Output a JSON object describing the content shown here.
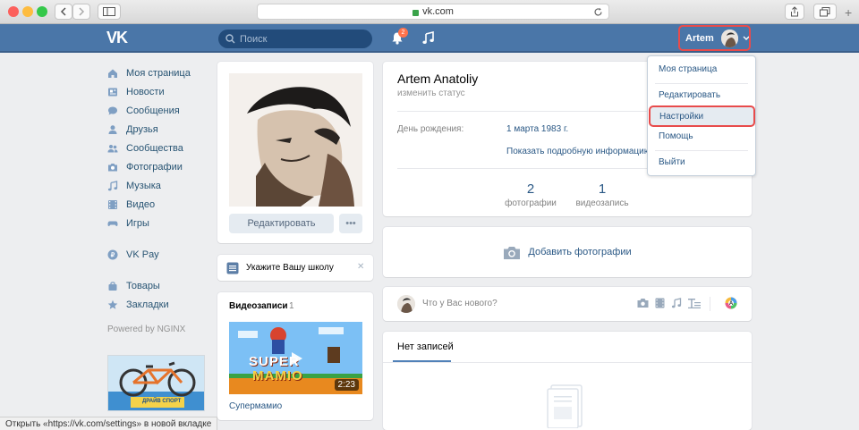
{
  "browser": {
    "url": "vk.com"
  },
  "header": {
    "logo": "VK",
    "search_placeholder": "Поиск",
    "notifications_count": "2",
    "profile_name": "Artem"
  },
  "left_menu": {
    "items": [
      {
        "label": "Моя страница",
        "icon": "home-icon"
      },
      {
        "label": "Новости",
        "icon": "news-icon"
      },
      {
        "label": "Сообщения",
        "icon": "messages-icon"
      },
      {
        "label": "Друзья",
        "icon": "friends-icon"
      },
      {
        "label": "Сообщества",
        "icon": "communities-icon"
      },
      {
        "label": "Фотографии",
        "icon": "camera-icon"
      },
      {
        "label": "Музыка",
        "icon": "music-icon"
      },
      {
        "label": "Видео",
        "icon": "video-icon"
      },
      {
        "label": "Игры",
        "icon": "gamepad-icon"
      }
    ],
    "vkpay": "VK Pay",
    "extra": [
      {
        "label": "Товары",
        "icon": "bag-icon"
      },
      {
        "label": "Закладки",
        "icon": "star-icon"
      }
    ],
    "powered": "Powered by NGINX",
    "ad_text": "ДРАЙВ СПОРТ"
  },
  "profile_photo_card": {
    "edit_label": "Редактировать",
    "more_label": "•••"
  },
  "school_card": {
    "label": "Укажите Вашу школу",
    "close": "✕"
  },
  "videos_card": {
    "title": "Видеозаписи",
    "count": "1",
    "video": {
      "title": "Супермамио",
      "duration": "2:23",
      "thumb_text_1": "SUPER",
      "thumb_text_2": "MAMIO"
    }
  },
  "info_card": {
    "name": "Artem Anatoliy",
    "status": "изменить статус",
    "birthday_label": "День рождения:",
    "birthday_value": "1 марта 1983 г.",
    "more_info": "Показать подробную информацию",
    "counters": [
      {
        "n": "2",
        "label": "фотографии"
      },
      {
        "n": "1",
        "label": "видеозапись"
      }
    ]
  },
  "add_photo": {
    "label": "Добавить фотографии"
  },
  "post_box": {
    "placeholder": "Что у Вас нового?"
  },
  "wall": {
    "tab": "Нет записей"
  },
  "dropdown": {
    "items": [
      "Моя страница",
      "Редактировать",
      "Настройки",
      "Помощь",
      "Выйти"
    ]
  },
  "statusbar": {
    "text": "Открыть «https://vk.com/settings» в новой вкладке"
  },
  "colors": {
    "header": "#4a76a8",
    "link": "#2a5885",
    "highlight": "#e84b4b"
  }
}
